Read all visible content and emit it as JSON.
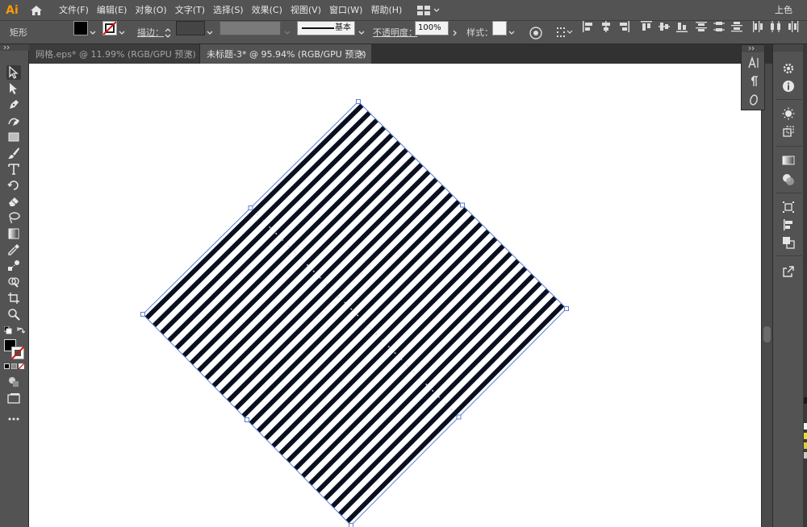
{
  "app": {
    "logo": "Ai",
    "workspace": "上色"
  },
  "menu": [
    "文件(F)",
    "编辑(E)",
    "对象(O)",
    "文字(T)",
    "选择(S)",
    "效果(C)",
    "视图(V)",
    "窗口(W)",
    "帮助(H)"
  ],
  "control": {
    "object_type": "矩形",
    "stroke_label": "描边：",
    "stroke_style": "基本",
    "opacity_label": "不透明度：",
    "opacity_value": "100%",
    "style_label": "样式："
  },
  "tabs": [
    {
      "label": "网格.eps* @ 11.99% (RGB/GPU 预览)",
      "close": "×"
    },
    {
      "label": "未标题-3* @ 95.94% (RGB/GPU 预览)",
      "close": "×"
    }
  ],
  "colors": {
    "stripe": "#0b1020",
    "selection": "#5a7fd8",
    "ui_dark": "#323232",
    "ui_mid": "#535353",
    "accent": "#ff9a00"
  },
  "tools": [
    "selection-tool",
    "direct-selection-tool",
    "pen-tool",
    "curvature-tool",
    "rectangle-tool",
    "paintbrush-tool",
    "type-tool",
    "rotate-tool",
    "eraser-tool",
    "lasso-tool",
    "gradient-tool",
    "eyedropper-tool",
    "blend-tool",
    "shape-builder-tool",
    "artboard-tool",
    "zoom-tool",
    "swap-fill-stroke",
    "fill-stroke-swatch",
    "color-mode-buttons",
    "draw-mode",
    "screen-mode",
    "more-tools"
  ],
  "type_panel": [
    "character-icon",
    "paragraph-icon",
    "opentype-icon"
  ],
  "dock_icons": [
    "properties-icon",
    "info-icon",
    "appearance-icon",
    "transform-icon",
    "gradient-panel-icon",
    "transparency-icon",
    "align-panel-icon",
    "layers-icon",
    "pathfinder-icon",
    "export-icon"
  ]
}
